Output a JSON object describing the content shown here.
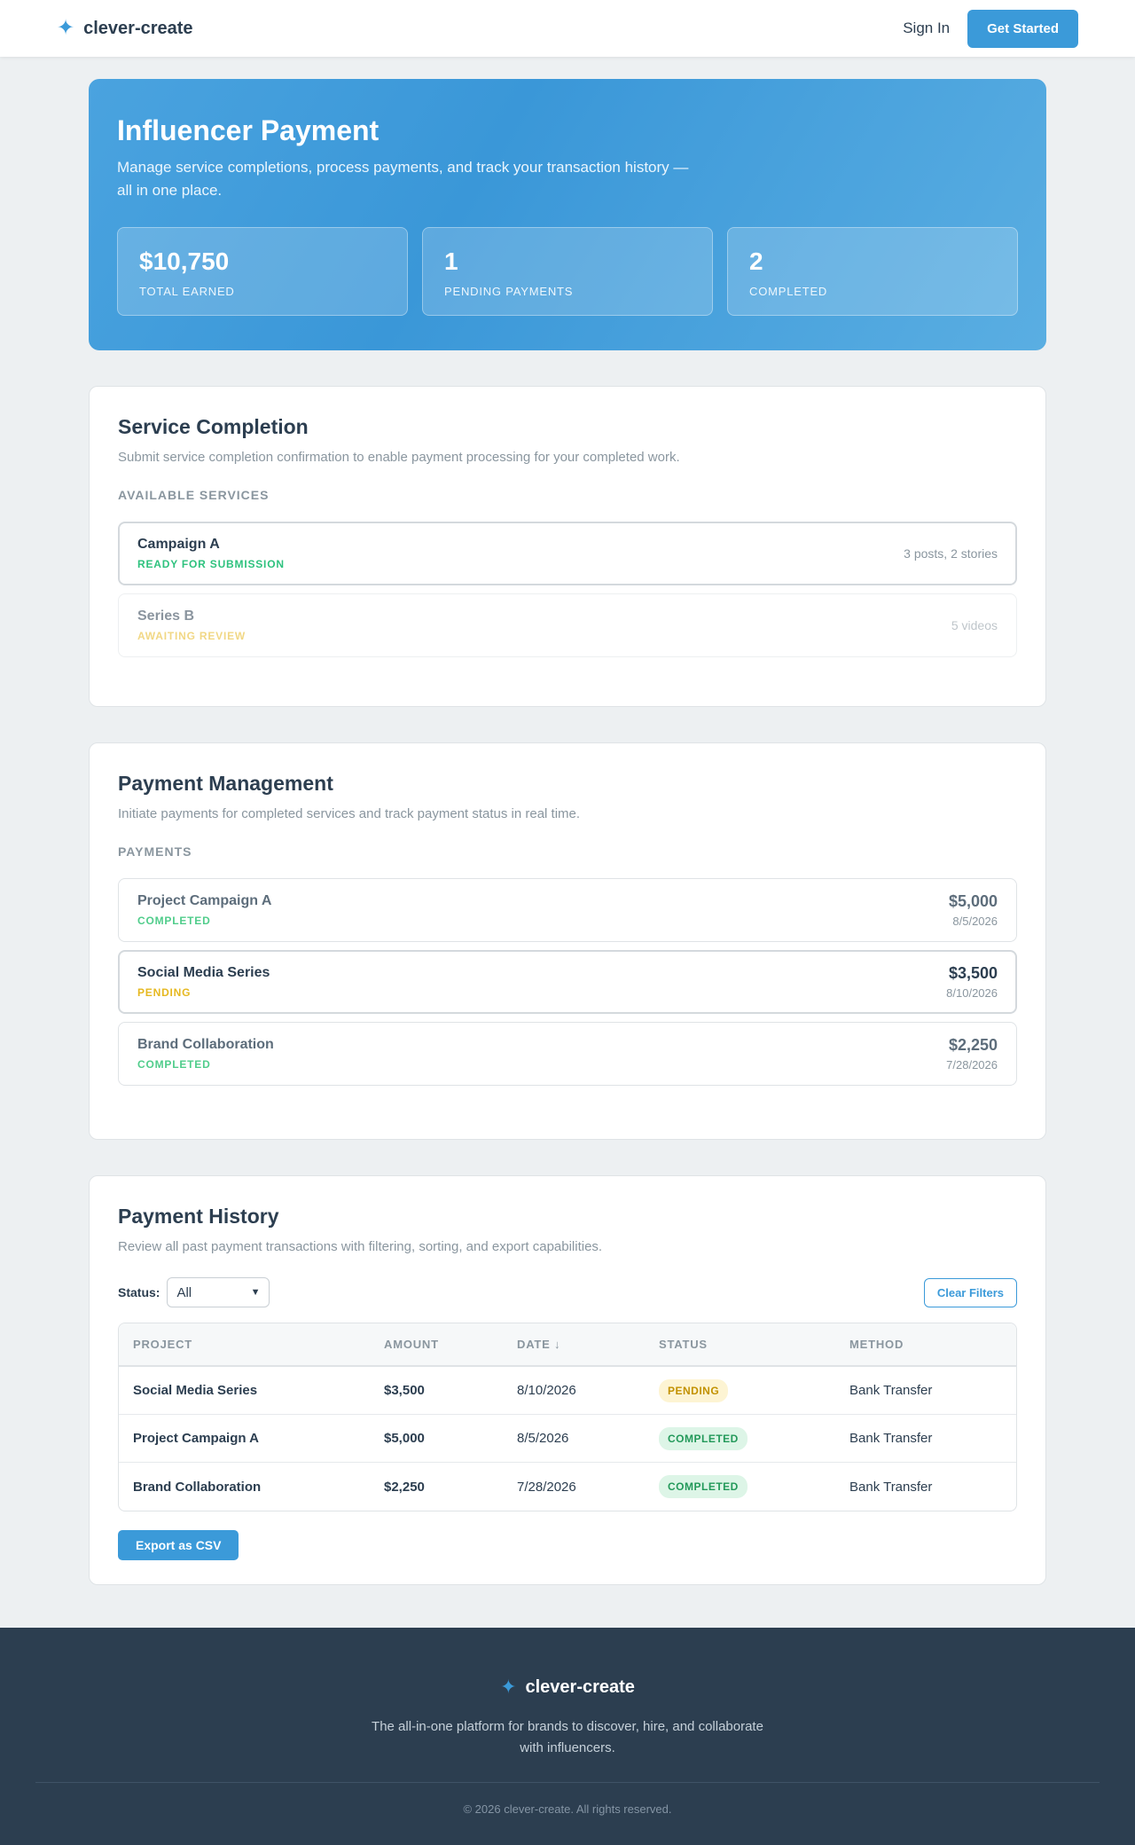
{
  "header": {
    "brand": "clever-create",
    "sign_in": "Sign In",
    "get_started": "Get Started"
  },
  "hero": {
    "title": "Influencer Payment",
    "subtitle": "Manage service completions, process payments, and track your transaction history — all in one place.",
    "stats": [
      {
        "value": "$10,750",
        "label": "TOTAL EARNED"
      },
      {
        "value": "1",
        "label": "PENDING PAYMENTS"
      },
      {
        "value": "2",
        "label": "COMPLETED"
      }
    ]
  },
  "service": {
    "title": "Service Completion",
    "description": "Submit service completion confirmation to enable payment processing for your completed work.",
    "section_label": "AVAILABLE SERVICES",
    "items": [
      {
        "name": "Campaign A",
        "status": "READY FOR SUBMISSION",
        "meta": "3 posts, 2 stories"
      },
      {
        "name": "Series B",
        "status": "AWAITING REVIEW",
        "meta": "5 videos"
      }
    ]
  },
  "payments": {
    "title": "Payment Management",
    "description": "Initiate payments for completed services and track payment status in real time.",
    "section_label": "PAYMENTS",
    "items": [
      {
        "name": "Project Campaign A",
        "status": "COMPLETED",
        "amount": "$5,000",
        "date": "8/5/2026"
      },
      {
        "name": "Social Media Series",
        "status": "PENDING",
        "amount": "$3,500",
        "date": "8/10/2026"
      },
      {
        "name": "Brand Collaboration",
        "status": "COMPLETED",
        "amount": "$2,250",
        "date": "7/28/2026"
      }
    ]
  },
  "history": {
    "title": "Payment History",
    "description": "Review all past payment transactions with filtering, sorting, and export capabilities.",
    "filter_label": "Status:",
    "filter_value": "All",
    "clear_filters": "Clear Filters",
    "columns": [
      "PROJECT",
      "AMOUNT",
      "DATE ↓",
      "STATUS",
      "METHOD"
    ],
    "rows": [
      {
        "project": "Social Media Series",
        "amount": "$3,500",
        "date": "8/10/2026",
        "status": "PENDING",
        "method": "Bank Transfer"
      },
      {
        "project": "Project Campaign A",
        "amount": "$5,000",
        "date": "8/5/2026",
        "status": "COMPLETED",
        "method": "Bank Transfer"
      },
      {
        "project": "Brand Collaboration",
        "amount": "$2,250",
        "date": "7/28/2026",
        "status": "COMPLETED",
        "method": "Bank Transfer"
      }
    ],
    "export": "Export as CSV"
  },
  "footer": {
    "brand": "clever-create",
    "tagline": "The all-in-one platform for brands to discover, hire, and collaborate with influencers.",
    "copyright": "© 2026 clever-create. All rights reserved."
  },
  "colors": {
    "accent": "#3b9ad9",
    "success": "#2ec27e",
    "warning": "#e6b820",
    "footer_bg": "#2c3e50"
  },
  "icons": {
    "brand": "sparkle-icon",
    "select": "chevron-down-icon"
  }
}
